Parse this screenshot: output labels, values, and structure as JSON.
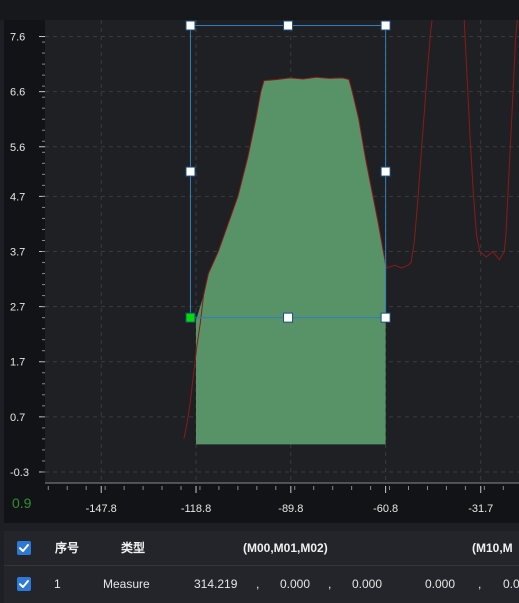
{
  "chart_data": {
    "type": "area",
    "xlim": [
      -165,
      -20
    ],
    "ylim": [
      -0.5,
      7.9
    ],
    "x_ticks": [
      -147.8,
      -118.8,
      -89.8,
      -60.8,
      -31.7
    ],
    "x_tick_labels": [
      "-147.8",
      "-118.8",
      "-89.8",
      "-60.8",
      "-31.7"
    ],
    "y_ticks": [
      7.6,
      6.6,
      5.6,
      4.7,
      3.7,
      2.7,
      1.7,
      0.7,
      -0.3
    ],
    "y_tick_labels": [
      "7.6",
      "6.6",
      "5.6",
      "4.7",
      "3.7",
      "2.7",
      "1.7",
      "0.7",
      "-0.3"
    ],
    "grid": true,
    "series": [
      {
        "color": "#8b1a1a",
        "points": [
          [
            -122.5,
            0.3
          ],
          [
            -121.5,
            0.6
          ],
          [
            -120.5,
            1.0
          ],
          [
            -119.5,
            1.5
          ],
          [
            -118.5,
            2.0
          ],
          [
            -117.5,
            2.4
          ],
          [
            -116.5,
            2.9
          ],
          [
            -115,
            3.3
          ],
          [
            -112,
            3.7
          ],
          [
            -109,
            4.2
          ],
          [
            -106,
            4.7
          ],
          [
            -103,
            5.4
          ],
          [
            -100.5,
            6.1
          ],
          [
            -99,
            6.6
          ],
          [
            -98,
            6.8
          ],
          [
            -94,
            6.82
          ],
          [
            -90,
            6.85
          ],
          [
            -86,
            6.83
          ],
          [
            -82,
            6.86
          ],
          [
            -78,
            6.84
          ],
          [
            -74,
            6.85
          ],
          [
            -72,
            6.82
          ],
          [
            -71,
            6.6
          ],
          [
            -69,
            6.1
          ],
          [
            -67,
            5.4
          ],
          [
            -65,
            4.8
          ],
          [
            -63,
            4.2
          ],
          [
            -61.5,
            3.7
          ],
          [
            -60.5,
            3.4
          ],
          [
            -58,
            3.45
          ],
          [
            -56,
            3.4
          ],
          [
            -54,
            3.45
          ],
          [
            -53,
            3.5
          ],
          [
            -52,
            3.9
          ],
          [
            -51,
            4.6
          ],
          [
            -50,
            5.4
          ],
          [
            -49,
            6.2
          ],
          [
            -48,
            7.0
          ],
          [
            -47,
            7.7
          ],
          [
            -46.2,
            8.1
          ]
        ]
      },
      {
        "color": "#8b1a1a",
        "points": [
          [
            -37,
            8.2
          ],
          [
            -36,
            7.0
          ],
          [
            -35,
            5.8
          ],
          [
            -34,
            4.8
          ],
          [
            -33,
            4.0
          ],
          [
            -32,
            3.7
          ],
          [
            -30,
            3.6
          ],
          [
            -28,
            3.7
          ],
          [
            -26,
            3.55
          ],
          [
            -24.5,
            3.7
          ],
          [
            -24,
            4.0
          ],
          [
            -23,
            5.2
          ],
          [
            -22,
            6.4
          ],
          [
            -21,
            7.6
          ],
          [
            -20,
            8.2
          ]
        ]
      }
    ],
    "highlight": {
      "color": "#5b9a6b",
      "points": [
        [
          -118.8,
          0.2
        ],
        [
          -118.8,
          2.45
        ],
        [
          -116.5,
          2.9
        ],
        [
          -115,
          3.3
        ],
        [
          -112,
          3.7
        ],
        [
          -109,
          4.2
        ],
        [
          -106,
          4.7
        ],
        [
          -103,
          5.4
        ],
        [
          -100.5,
          6.1
        ],
        [
          -99,
          6.6
        ],
        [
          -98,
          6.8
        ],
        [
          -94,
          6.82
        ],
        [
          -90,
          6.85
        ],
        [
          -86,
          6.83
        ],
        [
          -82,
          6.86
        ],
        [
          -78,
          6.84
        ],
        [
          -74,
          6.85
        ],
        [
          -72,
          6.82
        ],
        [
          -71,
          6.6
        ],
        [
          -69,
          6.1
        ],
        [
          -67,
          5.4
        ],
        [
          -65,
          4.8
        ],
        [
          -63,
          4.2
        ],
        [
          -61.5,
          3.7
        ],
        [
          -60.8,
          3.4
        ],
        [
          -60.8,
          0.2
        ]
      ]
    },
    "selection_box": {
      "x_range": [
        -120.5,
        -60.8
      ],
      "y_range": [
        2.5,
        7.8
      ],
      "border_color": "#2f7fbf",
      "handle_color": "#ffffff",
      "anchor_handle_color": "#00dd00"
    },
    "corner_value": "0.9",
    "corner_value_color": "#2f8f2f"
  },
  "table": {
    "headers": {
      "index": "序号",
      "type": "类型",
      "group1": "(M00,M01,M02)",
      "group2": "(M10,M"
    },
    "row": {
      "index": "1",
      "type": "Measure",
      "v1": "314.219",
      "sep1": ",",
      "v2": "0.000",
      "sep2": ",",
      "v3": "0.000",
      "v4": "0.000",
      "sep3": ",",
      "v5": "0.0"
    }
  }
}
